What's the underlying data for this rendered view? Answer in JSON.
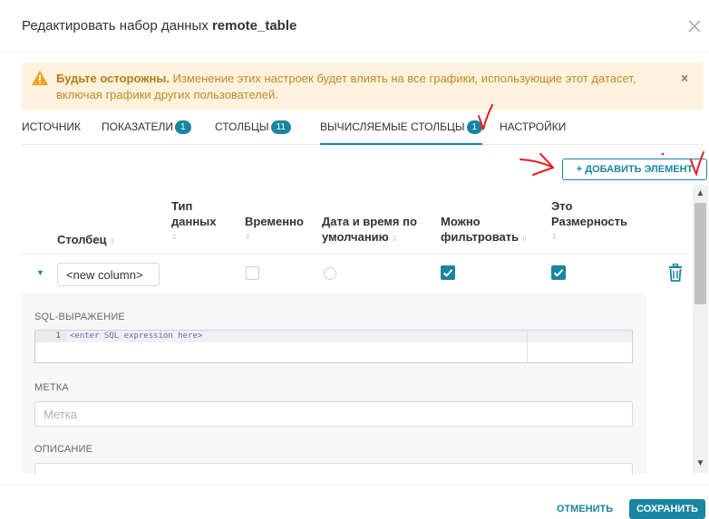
{
  "modal": {
    "title_prefix": "Редактировать набор данных",
    "title_name": "remote_table"
  },
  "alert": {
    "bold": "Будьте осторожны.",
    "text": " Изменение этих настроек будет влиять на все графики, использующие этот датасет, включая графики других пользователей.",
    "close": "×"
  },
  "tabs": [
    {
      "label": "ИСТОЧНИК",
      "badge": ""
    },
    {
      "label": "ПОКАЗАТЕЛИ",
      "badge": "1"
    },
    {
      "label": "СТОЛБЦЫ",
      "badge": "11"
    },
    {
      "label": "ВЫЧИСЛЯЕМЫЕ СТОЛБЦЫ",
      "badge": "1"
    },
    {
      "label": "НАСТРОЙКИ",
      "badge": ""
    }
  ],
  "toolbar": {
    "add_label": "+ ДОБАВИТЬ ЭЛЕМЕНТ"
  },
  "table": {
    "columns": {
      "column": "Столбец",
      "type_l1": "Тип",
      "type_l2": "данных",
      "temporal": "Временно",
      "default_dt_l1": "Дата и время по",
      "default_dt_l2": "умолчанию",
      "filterable_l1": "Можно",
      "filterable_l2": "фильтровать",
      "dimension_l1": "Это",
      "dimension_l2": "Размерность"
    },
    "sort_glyph": "⇕",
    "row": {
      "column_value": "<new column>",
      "temporal": false,
      "default_datetime": false,
      "filterable": true,
      "dimension": true
    }
  },
  "detail": {
    "sql_label": "SQL-ВЫРАЖЕНИЕ",
    "sql_line_no": "1",
    "sql_placeholder": "<enter SQL expression here>",
    "label_label": "МЕТКА",
    "label_placeholder": "Метка",
    "description_label": "ОПИСАНИЕ"
  },
  "footer": {
    "cancel_label": "ОТМЕНИТЬ",
    "save_label": "СОХРАНИТЬ"
  },
  "scroll": {
    "up": "▲",
    "down": "▼"
  },
  "icons": {
    "close": "close-icon",
    "warning": "warning-icon",
    "trash": "trash-icon",
    "caret": "caret-down-icon",
    "check": "check-icon"
  },
  "colors": {
    "accent": "#1985a0",
    "warning_bg": "#fdf2dd",
    "warning_text": "#c08a24",
    "annotation": "#e32020"
  }
}
